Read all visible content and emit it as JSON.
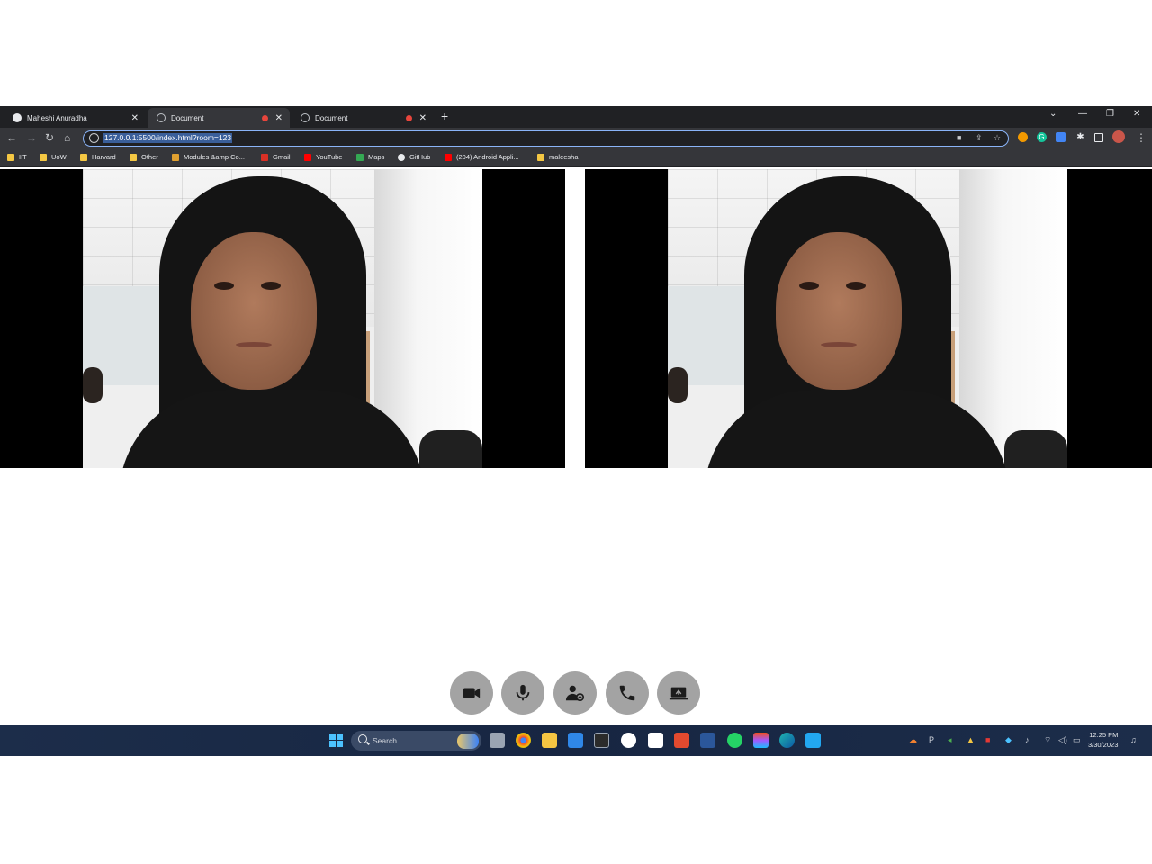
{
  "browser": {
    "tabs": [
      {
        "title": "Maheshi Anuradha",
        "recording": false
      },
      {
        "title": "Document",
        "recording": true
      },
      {
        "title": "Document",
        "recording": true
      }
    ],
    "new_tab": "+",
    "address": "127.0.0.1:5500/index.html?room=123",
    "bookmarks": [
      {
        "label": "IIT",
        "icon": "folder-icon"
      },
      {
        "label": "UoW",
        "icon": "folder-icon"
      },
      {
        "label": "Harvard",
        "icon": "folder-icon"
      },
      {
        "label": "Other",
        "icon": "folder-icon"
      },
      {
        "label": "Modules &amp Co...",
        "icon": "modules-icon"
      },
      {
        "label": "Gmail",
        "icon": "gmail-icon"
      },
      {
        "label": "YouTube",
        "icon": "youtube-icon"
      },
      {
        "label": "Maps",
        "icon": "maps-icon"
      },
      {
        "label": "GitHub",
        "icon": "github-icon"
      },
      {
        "label": "(204) Android Appli...",
        "icon": "youtube-icon"
      },
      {
        "label": "maleesha",
        "icon": "folder-icon"
      }
    ]
  },
  "videos": [
    {
      "name": "local-video"
    },
    {
      "name": "remote-video"
    }
  ],
  "controls": [
    {
      "name": "camera-button",
      "icon": "video-camera-icon"
    },
    {
      "name": "microphone-button",
      "icon": "microphone-icon"
    },
    {
      "name": "participants-button",
      "icon": "add-user-icon"
    },
    {
      "name": "end-call-button",
      "icon": "phone-icon"
    },
    {
      "name": "screen-share-button",
      "icon": "screen-share-icon"
    }
  ],
  "taskbar": {
    "search_label": "Search",
    "time": "12:25 PM",
    "date": "3/30/2023"
  },
  "colors": {
    "control_bg": "#a3a3a3",
    "tab_bar": "#202124",
    "toolbar": "#35363a",
    "accent": "#8ab4f8"
  }
}
